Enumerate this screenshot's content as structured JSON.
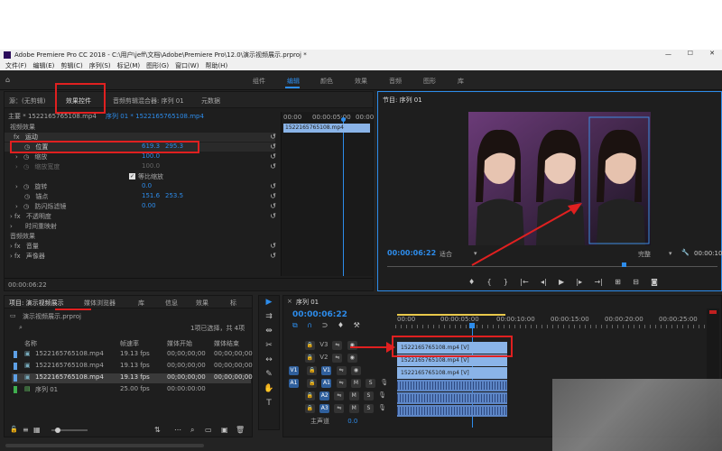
{
  "window": {
    "title": "Adobe Premiere Pro CC 2018 - C:\\用户\\jeff\\文档\\Adobe\\Premiere Pro\\12.0\\演示视频展示.prproj *"
  },
  "menu": [
    "文件(F)",
    "编辑(E)",
    "剪辑(C)",
    "序列(S)",
    "标记(M)",
    "图形(G)",
    "窗口(W)",
    "帮助(H)"
  ],
  "workspaces": [
    "组件",
    "编辑",
    "颜色",
    "效果",
    "音频",
    "图形",
    "库"
  ],
  "active_workspace": "编辑",
  "effect_controls": {
    "tabs": [
      "源：(无剪辑)",
      "效果控件",
      "音频剪辑混合器: 序列 01",
      "元数据"
    ],
    "active_tab": "效果控件",
    "master_label": "主要 * 1522165765108.mp4",
    "sequence_label": "序列 01 * 1522165765108.mp4",
    "mini_timeline_times": [
      "00:00",
      "00:00:05:00",
      "00:00"
    ],
    "clip_name": "1522165765108.mp4",
    "section_video": "视频效果",
    "motion": "运动",
    "properties": [
      {
        "label": "位置",
        "value": "619.3",
        "value2": "295.3"
      },
      {
        "label": "缩放",
        "value": "100.0"
      },
      {
        "label": "缩放宽度",
        "value": "100.0"
      },
      {
        "label": "等比缩放",
        "checkbox": true
      },
      {
        "label": "旋转",
        "value": "0.0"
      },
      {
        "label": "锚点",
        "value": "151.6",
        "value2": "253.5"
      },
      {
        "label": "防闪烁滤镜",
        "value": "0.00"
      }
    ],
    "opacity": "不透明度",
    "time_remap": "时间重映射",
    "section_audio": "音频效果",
    "volume": "音量",
    "channel_volume": "声像器",
    "timecode": "00:00:06:22"
  },
  "program": {
    "title": "节目: 序列 01",
    "timecode": "00:00:06:22",
    "fit": "适合",
    "quality": "完整",
    "duration": "00:00:10"
  },
  "project": {
    "tabs": [
      "项目: 演示视频展示",
      "媒体浏览器",
      "库",
      "信息",
      "效果",
      "标"
    ],
    "path": "演示视频展示.prproj",
    "selection": "1项已选择，共 4项",
    "columns": [
      "名称",
      "帧速率",
      "媒体开始",
      "媒体结束"
    ],
    "items": [
      {
        "name": "1522165765108.mp4",
        "fps": "19.13 fps",
        "start": "00;00;00;00",
        "end": "00;00;00;00",
        "color": "#5ea0e6"
      },
      {
        "name": "1522165765108.mp4",
        "fps": "19.13 fps",
        "start": "00;00;00;00",
        "end": "00;00;00;00",
        "color": "#5ea0e6"
      },
      {
        "name": "1522165765108.mp4",
        "fps": "19.13 fps",
        "start": "00;00;00;00",
        "end": "00;00;00;00",
        "color": "#5ea0e6"
      },
      {
        "name": "序列 01",
        "fps": "25.00 fps",
        "start": "00:00:00:00",
        "end": "",
        "color": "#3fae4e"
      }
    ]
  },
  "timeline": {
    "title": "序列 01",
    "timecode": "00:00:06:22",
    "ruler": [
      "00:00",
      "00:00:05:00",
      "00:00:10:00",
      "00:00:15:00",
      "00:00:20:00",
      "00:00:25:00"
    ],
    "tracks": [
      {
        "target": "",
        "name": "V3"
      },
      {
        "target": "",
        "name": "V2"
      },
      {
        "target": "V1",
        "name": "V1"
      },
      {
        "target": "A1",
        "name": "A1"
      },
      {
        "target": "",
        "name": "A2"
      },
      {
        "target": "",
        "name": "A3"
      }
    ],
    "clips": {
      "v3": "1522165765108.mp4 [V]",
      "v2": "1522165765108.mp4 [V]",
      "v1": "1522165765108.mp4 [V]"
    },
    "master": "主声道",
    "master_value": "0.0"
  },
  "colors": {
    "accent": "#2d8ceb",
    "highlight": "#e02020"
  }
}
